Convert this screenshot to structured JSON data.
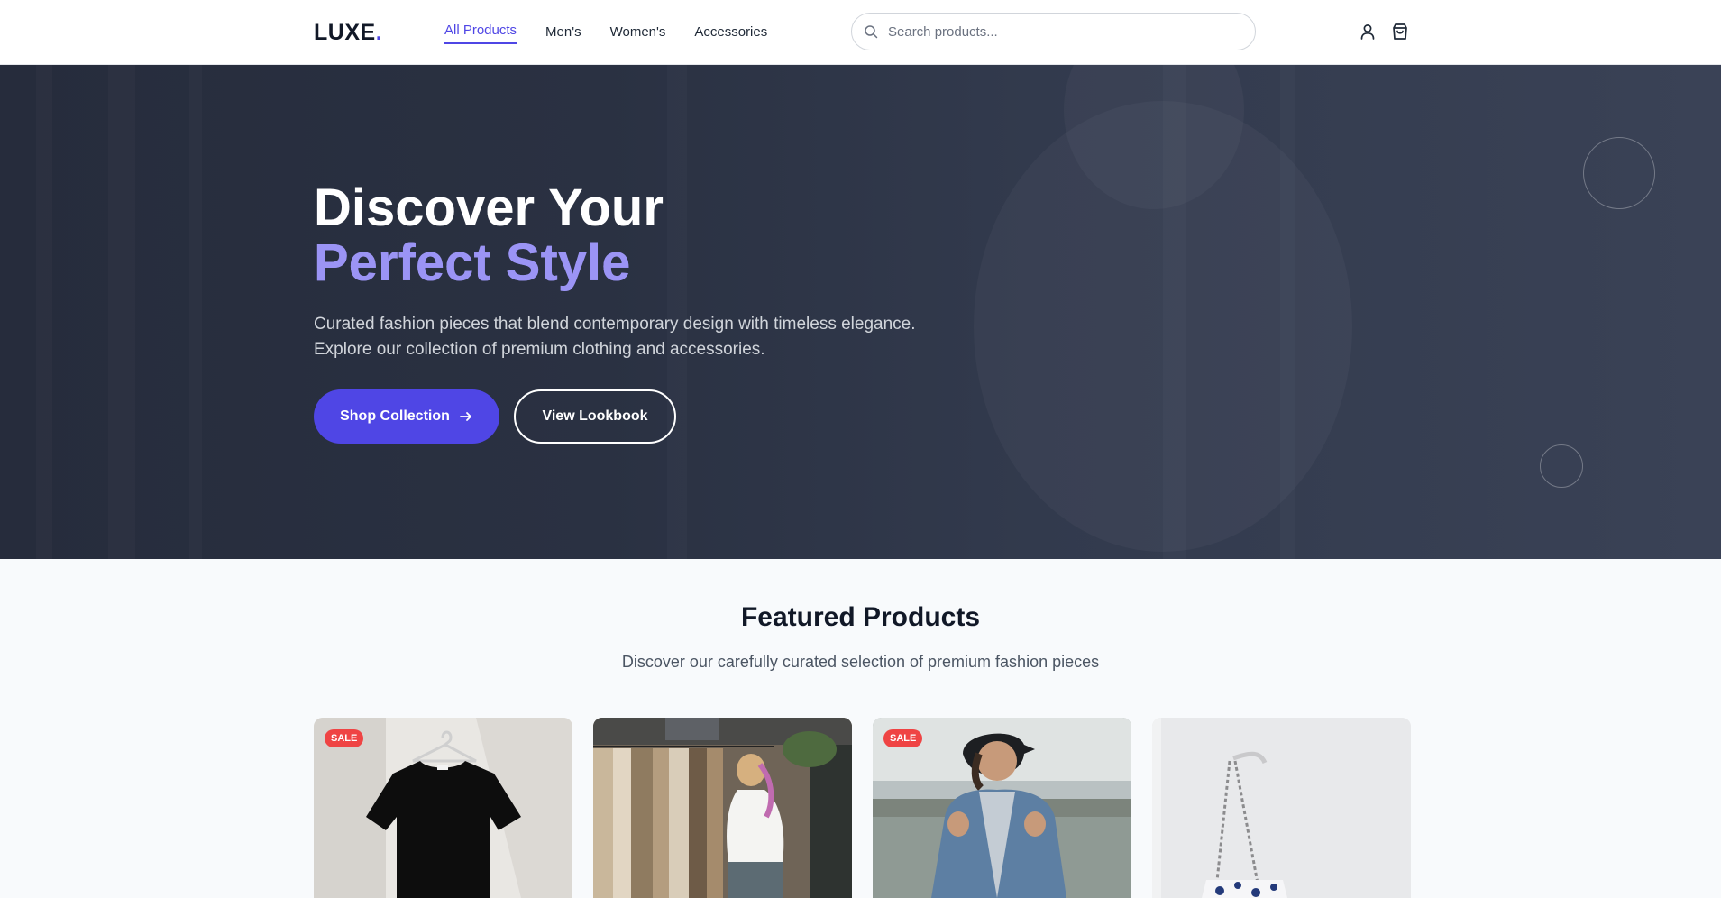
{
  "brand": {
    "name": "LUXE",
    "dot": "."
  },
  "nav": {
    "items": [
      {
        "label": "All Products",
        "active": true
      },
      {
        "label": "Men's",
        "active": false
      },
      {
        "label": "Women's",
        "active": false
      },
      {
        "label": "Accessories",
        "active": false
      }
    ]
  },
  "search": {
    "placeholder": "Search products...",
    "value": ""
  },
  "header_icons": [
    "user-icon",
    "shopping-bag-icon"
  ],
  "hero": {
    "title_line1": "Discover Your",
    "title_line2": "Perfect Style",
    "subtitle_line1": "Curated fashion pieces that blend contemporary design with timeless elegance.",
    "subtitle_line2": "Explore our collection of premium clothing and accessories.",
    "primary_button": "Shop Collection",
    "secondary_button": "View Lookbook"
  },
  "featured": {
    "title": "Featured Products",
    "subtitle": "Discover our carefully curated selection of premium fashion pieces",
    "products": [
      {
        "image": "black-tshirt-on-hanger",
        "badge": "SALE"
      },
      {
        "image": "woman-browsing-clothing-rack",
        "badge": ""
      },
      {
        "image": "man-in-denim-jacket-and-cap",
        "badge": "SALE"
      },
      {
        "image": "chain-strap-handbag",
        "badge": ""
      }
    ]
  },
  "colors": {
    "accent": "#4f46e5",
    "sale_badge": "#ef4444",
    "hero_bg": "#2a3142",
    "hero_title_accent": "#9b94f5"
  }
}
